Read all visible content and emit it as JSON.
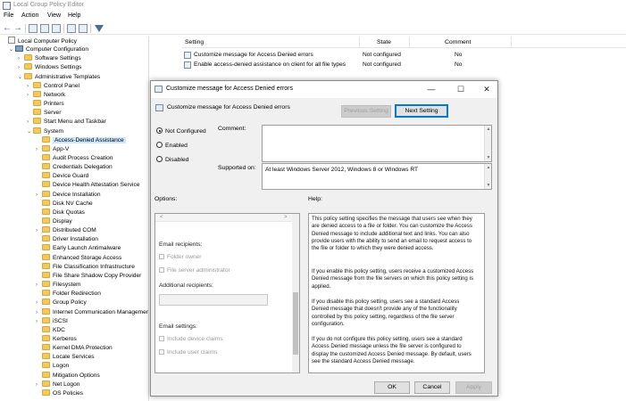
{
  "window": {
    "title": "Local Group Policy Editor"
  },
  "menu": [
    "File",
    "Action",
    "View",
    "Help"
  ],
  "toolbar": {
    "icons": [
      "back-arrow-icon",
      "forward-arrow-icon",
      "folder-up-icon",
      "show-hide-tree-icon",
      "export-list-icon",
      "help-icon",
      "properties-icon",
      "filter-icon"
    ]
  },
  "tree": {
    "items": [
      {
        "label": "Local Computer Policy",
        "level": 0,
        "twisty": "",
        "icon": "doc"
      },
      {
        "label": "Computer Configuration",
        "level": 1,
        "twisty": "v",
        "icon": "computer"
      },
      {
        "label": "Software Settings",
        "level": 2,
        "twisty": ">",
        "icon": "folder"
      },
      {
        "label": "Windows Settings",
        "level": 2,
        "twisty": ">",
        "icon": "folder"
      },
      {
        "label": "Administrative Templates",
        "level": 2,
        "twisty": "v",
        "icon": "folder"
      },
      {
        "label": "Control Panel",
        "level": 3,
        "twisty": ">",
        "icon": "folder"
      },
      {
        "label": "Network",
        "level": 3,
        "twisty": ">",
        "icon": "folder"
      },
      {
        "label": "Printers",
        "level": 3,
        "twisty": "",
        "icon": "folder"
      },
      {
        "label": "Server",
        "level": 3,
        "twisty": "",
        "icon": "folder"
      },
      {
        "label": "Start Menu and Taskbar",
        "level": 3,
        "twisty": ">",
        "icon": "folder"
      },
      {
        "label": "System",
        "level": 3,
        "twisty": "v",
        "icon": "folder"
      },
      {
        "label": "Access-Denied Assistance",
        "level": 4,
        "twisty": "",
        "icon": "folder",
        "selected": true
      },
      {
        "label": "App-V",
        "level": 4,
        "twisty": ">",
        "icon": "folder"
      },
      {
        "label": "Audit Process Creation",
        "level": 4,
        "twisty": "",
        "icon": "folder"
      },
      {
        "label": "Credentials Delegation",
        "level": 4,
        "twisty": "",
        "icon": "folder"
      },
      {
        "label": "Device Guard",
        "level": 4,
        "twisty": "",
        "icon": "folder"
      },
      {
        "label": "Device Health Attestation Service",
        "level": 4,
        "twisty": "",
        "icon": "folder"
      },
      {
        "label": "Device Installation",
        "level": 4,
        "twisty": ">",
        "icon": "folder"
      },
      {
        "label": "Disk NV Cache",
        "level": 4,
        "twisty": "",
        "icon": "folder"
      },
      {
        "label": "Disk Quotas",
        "level": 4,
        "twisty": "",
        "icon": "folder"
      },
      {
        "label": "Display",
        "level": 4,
        "twisty": "",
        "icon": "folder"
      },
      {
        "label": "Distributed COM",
        "level": 4,
        "twisty": ">",
        "icon": "folder"
      },
      {
        "label": "Driver Installation",
        "level": 4,
        "twisty": "",
        "icon": "folder"
      },
      {
        "label": "Early Launch Antimalware",
        "level": 4,
        "twisty": "",
        "icon": "folder"
      },
      {
        "label": "Enhanced Storage Access",
        "level": 4,
        "twisty": "",
        "icon": "folder"
      },
      {
        "label": "File Classification Infrastructure",
        "level": 4,
        "twisty": "",
        "icon": "folder"
      },
      {
        "label": "File Share Shadow Copy Provider",
        "level": 4,
        "twisty": "",
        "icon": "folder"
      },
      {
        "label": "Filesystem",
        "level": 4,
        "twisty": ">",
        "icon": "folder"
      },
      {
        "label": "Folder Redirection",
        "level": 4,
        "twisty": "",
        "icon": "folder"
      },
      {
        "label": "Group Policy",
        "level": 4,
        "twisty": ">",
        "icon": "folder"
      },
      {
        "label": "Internet Communication Managemen",
        "level": 4,
        "twisty": ">",
        "icon": "folder"
      },
      {
        "label": "iSCSI",
        "level": 4,
        "twisty": ">",
        "icon": "folder"
      },
      {
        "label": "KDC",
        "level": 4,
        "twisty": "",
        "icon": "folder"
      },
      {
        "label": "Kerberos",
        "level": 4,
        "twisty": "",
        "icon": "folder"
      },
      {
        "label": "Kernel DMA Protection",
        "level": 4,
        "twisty": "",
        "icon": "folder"
      },
      {
        "label": "Locale Services",
        "level": 4,
        "twisty": "",
        "icon": "folder"
      },
      {
        "label": "Logon",
        "level": 4,
        "twisty": "",
        "icon": "folder"
      },
      {
        "label": "Mitigation Options",
        "level": 4,
        "twisty": "",
        "icon": "folder"
      },
      {
        "label": "Net Logon",
        "level": 4,
        "twisty": ">",
        "icon": "folder"
      },
      {
        "label": "OS Policies",
        "level": 4,
        "twisty": "",
        "icon": "folder"
      }
    ]
  },
  "list": {
    "headers": {
      "setting": "Setting",
      "state": "State",
      "comment": "Comment"
    },
    "rows": [
      {
        "setting": "Customize message for Access Denied errors",
        "state": "Not configured",
        "comment": "No"
      },
      {
        "setting": "Enable access-denied assistance on client for all file types",
        "state": "Not configured",
        "comment": "No"
      }
    ]
  },
  "dialog": {
    "title": "Customize message for Access Denied errors",
    "subtitle": "Customize message for Access Denied errors",
    "prev_label": "Previous Setting",
    "next_label": "Next Setting",
    "radios": [
      {
        "label": "Not Configured",
        "checked": true
      },
      {
        "label": "Enabled",
        "checked": false
      },
      {
        "label": "Disabled",
        "checked": false
      }
    ],
    "comment_label": "Comment:",
    "supported_label": "Supported on:",
    "supported_value": "At least Windows Server 2012, Windows 8 or Windows RT",
    "options_label": "Options:",
    "help_label": "Help:",
    "options": {
      "email_recipients": "Email recipients:",
      "folder_owner": "Folder owner",
      "file_server_admin": "File server administrator",
      "additional_recipients": "Additional recipients:",
      "email_settings": "Email settings:",
      "include_device_claims": "Include device claims",
      "include_user_claims": "Include user claims"
    },
    "help": [
      "This policy setting specifies the message that users see when they are denied access to a file or folder. You can customize the Access Denied message to include additional text and links. You can also provide users with the ability to send an email to request access to the file or folder to which they were denied access.",
      "If you enable this policy setting, users receive a customized Access Denied message from the file servers on which this policy setting is applied.",
      "If you disable this policy setting, users see a standard Access Denied message that doesn't provide any of the functionality controlled by this policy setting, regardless of the file server configuration.",
      "If you do not configure this policy setting, users see a standard Access Denied message unless the file server is configured to display the customized Access Denied message. By default, users see the standard Access Denied message."
    ],
    "ok_label": "OK",
    "cancel_label": "Cancel",
    "apply_label": "Apply"
  }
}
